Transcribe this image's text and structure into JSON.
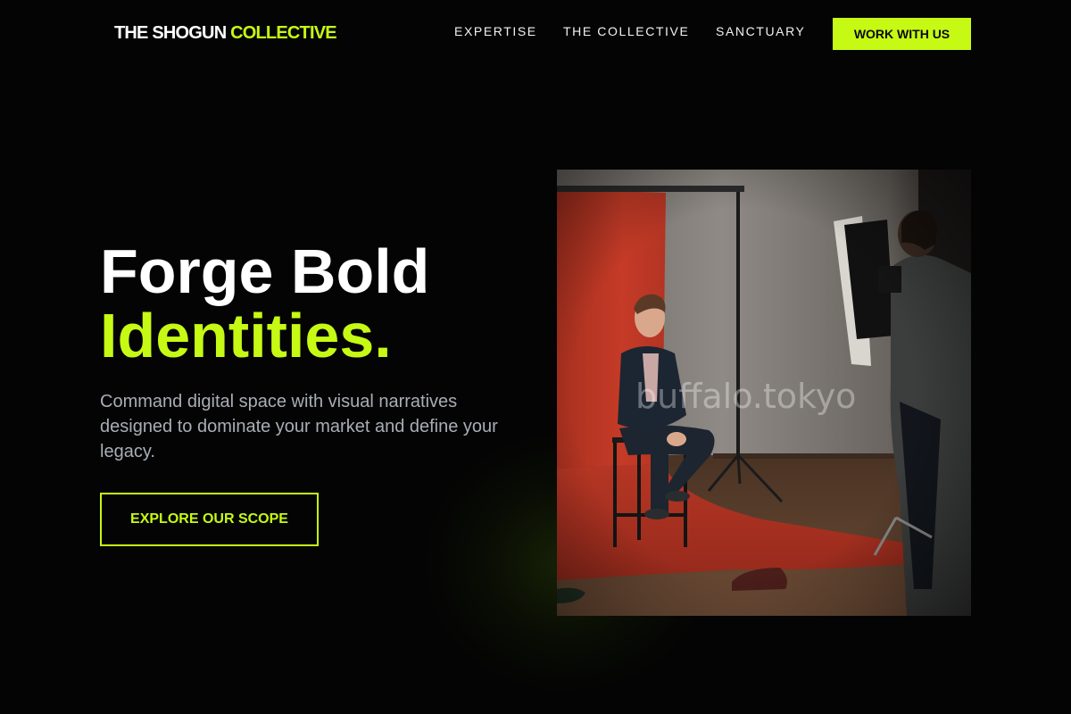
{
  "brand": {
    "part1": "THE SHOGUN",
    "part2": "COLLECTIVE"
  },
  "nav": {
    "items": [
      {
        "label": "EXPERTISE"
      },
      {
        "label": "THE COLLECTIVE"
      },
      {
        "label": "SANCTUARY"
      }
    ],
    "cta_label": "WORK WITH US"
  },
  "hero": {
    "title_line1": "Forge Bold",
    "title_line2": "Identities.",
    "subtitle": "Command digital space with visual narratives designed to dominate your market and define your legacy.",
    "button_label": "EXPLORE OUR SCOPE"
  },
  "image": {
    "watermark": "buffalo.tokyo"
  },
  "colors": {
    "accent": "#c6f914",
    "background": "#040404",
    "subtext": "#a9adb5"
  }
}
